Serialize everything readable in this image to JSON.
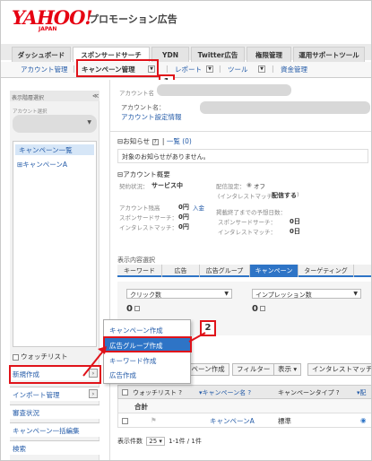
{
  "header": {
    "logo": "YAHOO!",
    "logo_sub": "JAPAN",
    "app_title": "プロモーション広告"
  },
  "main_tabs": [
    {
      "label": "ダッシュボード"
    },
    {
      "label": "スポンサードサーチ",
      "active": true
    },
    {
      "label": "YDN"
    },
    {
      "label": "Twitter広告"
    },
    {
      "label": "権限管理"
    },
    {
      "label": "運用サポートツール"
    }
  ],
  "subnav": {
    "account_mgmt": "アカウント管理",
    "campaign_mgmt": "キャンペーン管理",
    "report": "レポート",
    "tools": "ツール",
    "funds": "資金管理"
  },
  "sidebar": {
    "header": "表示階層選択",
    "collapse": "≪",
    "account_select_label": "アカウント選択",
    "tree_selected": "キャンペーン一覧",
    "tree_item": "⊞キャンペーンA",
    "watchlist": "ウォッチリスト",
    "buttons": {
      "new_create": "新規作成",
      "import_mgmt": "インポート管理",
      "review": "審査状況",
      "bulk_edit": "キャンペーン一括編集",
      "search": "検索"
    }
  },
  "account": {
    "name_label": "アカウント名",
    "name_label2": "アカウント名：",
    "settings_link": "アカウント設定情報"
  },
  "notice": {
    "title": "⊟お知らせ",
    "list_link": "一覧 (0)",
    "help": "?",
    "message": "対象のお知らせがありません。"
  },
  "summary": {
    "title": "⊟アカウント概要",
    "contract_status_label": "契約状況：",
    "contract_status_value": "サービス中",
    "delivery_label": "配信設定：",
    "delivery_value": "オフ",
    "intensity_label": "(インタレストマッチ：",
    "intensity_value": "配信する",
    "intensity_close": ")",
    "balance_label": "アカウント残高",
    "balance_value": "0円",
    "deposit_link": "入金",
    "ss_label": "スポンサードサーチ：",
    "ss_value": "0円",
    "im_label": "インタレストマッチ：",
    "im_value": "0円",
    "forecast_label": "掲載終了までの予想日数：",
    "ss2_label": "スポンサードサーチ：",
    "ss2_value": "0日",
    "im2_label": "インタレストマッチ：",
    "im2_value": "0日"
  },
  "display": {
    "label": "表示内容選択",
    "tabs": [
      "キーワード",
      "広告",
      "広告グループ",
      "キャンペーン",
      "ターゲティング"
    ],
    "active_tab": 3
  },
  "metrics": [
    {
      "select": "クリック数",
      "value": "0"
    },
    {
      "select": "インプレッション数",
      "value": "0"
    }
  ],
  "toolbar": {
    "create": "ンペーン作成",
    "filter": "フィルター",
    "display": "表示 ▾",
    "interest": "インタレストマッチ"
  },
  "grid": {
    "headers": [
      "ウォッチリスト ?",
      "▾キャンペーン名 ?",
      "キャンペーンタイプ ?",
      "▾配"
    ],
    "total_label": "合計",
    "rows": [
      {
        "name": "キャンペーンA",
        "type": "標準"
      }
    ]
  },
  "pager": {
    "label": "表示件数",
    "size": "25",
    "range": "1-1件 / 1件"
  },
  "popup": {
    "items": [
      "キャンペーン作成",
      "広告グループ作成",
      "キーワード作成",
      "広告作成"
    ],
    "selected": 1
  },
  "annotations": {
    "step1": "1",
    "step2": "2",
    "accent": "#e0131a",
    "brand": "#e60012",
    "active_blue": "#2e74c6"
  }
}
